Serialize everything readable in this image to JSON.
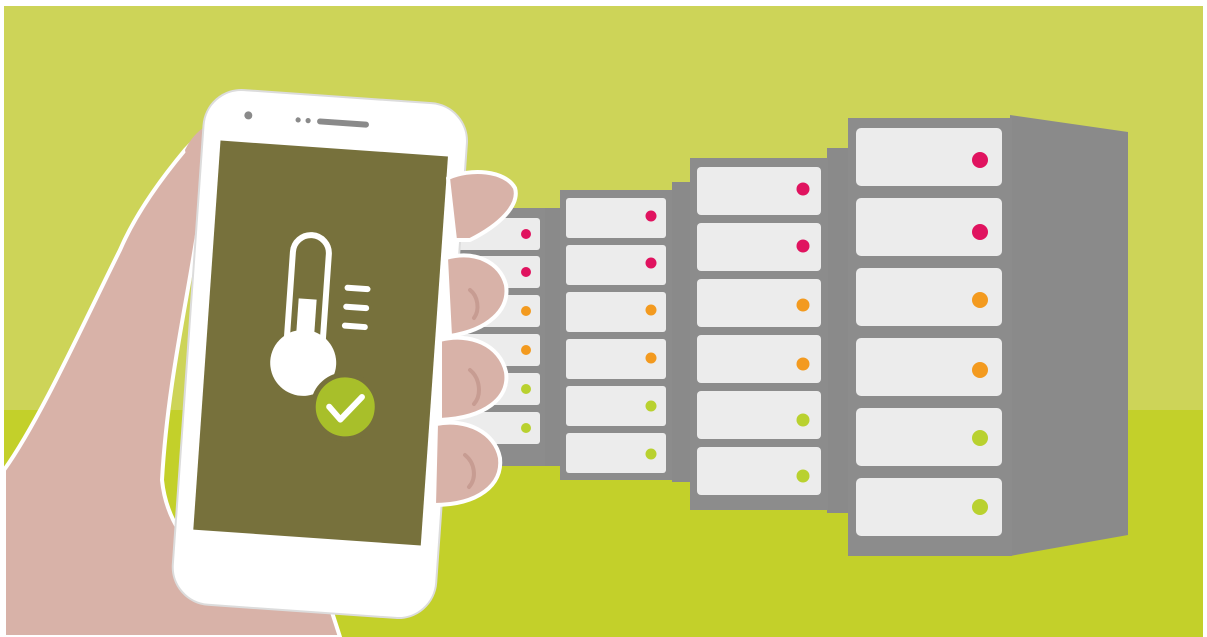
{
  "illustration": {
    "subject": "smartphone-temperature-monitoring-server-room",
    "icons": [
      "thermometer-icon",
      "checkmark-icon"
    ],
    "status_light_colors": {
      "alert": "#e0135f",
      "warning": "#f39a1f",
      "ok": "#b9d12f"
    },
    "colors": {
      "wall": "#cdd458",
      "floor": "#c3d02a",
      "rack_frame": "#8c8c8c",
      "rack_side": "#8a8a8a",
      "server_unit": "#ececec",
      "phone_screen": "#77713c",
      "skin": "#d8b2a8",
      "check_badge": "#a8bf2a"
    },
    "racks": [
      {
        "lights": [
          "alert",
          "alert",
          "warning",
          "warning",
          "ok",
          "ok"
        ]
      },
      {
        "lights": [
          "alert",
          "alert",
          "warning",
          "warning",
          "ok",
          "ok"
        ]
      },
      {
        "lights": [
          "alert",
          "alert",
          "warning",
          "warning",
          "ok",
          "ok"
        ]
      },
      {
        "lights": [
          "alert",
          "alert",
          "warning",
          "warning",
          "ok",
          "ok"
        ]
      }
    ]
  }
}
